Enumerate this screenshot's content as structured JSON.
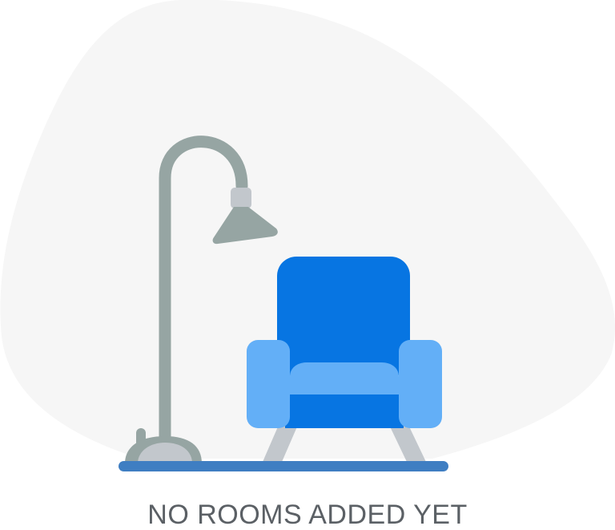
{
  "empty_state": {
    "message": "NO ROOMS ADDED YET",
    "illustration_icon": "lamp-and-armchair-illustration"
  },
  "colors": {
    "blob_background": "#f6f6f6",
    "armchair_primary": "#0775e2",
    "armchair_secondary": "#63aff7",
    "armchair_legs": "#c2c7cc",
    "lamp": "#96a5a3",
    "lamp_shade_cap": "#c2c7cc",
    "floor_line": "#3f7ec2",
    "message_text": "#5b6065"
  }
}
